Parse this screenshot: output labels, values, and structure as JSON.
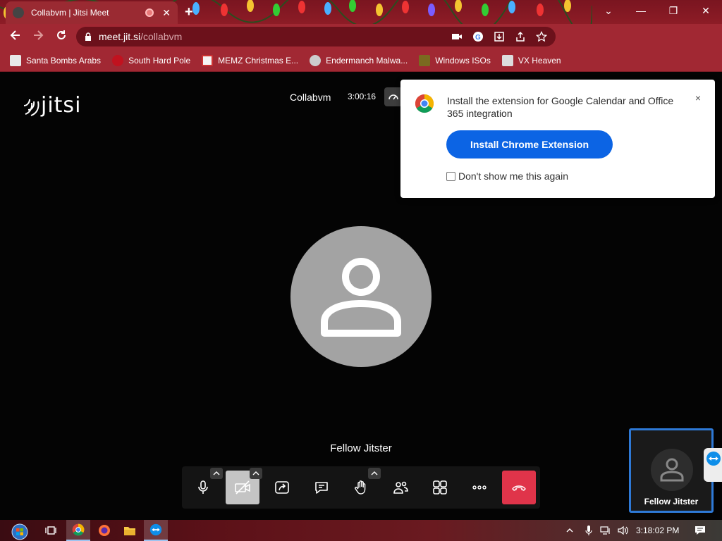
{
  "browser": {
    "tab_title": "Collabvm | Jitsi Meet",
    "new_tab_symbol": "+",
    "url_host": "meet.jit.si",
    "url_path": "/collabvm",
    "window_controls": [
      "chevron-down",
      "minimize",
      "restore",
      "close"
    ],
    "bookmarks": [
      {
        "label": "Santa Bombs Arabs",
        "icon": "santa-icon"
      },
      {
        "label": "South Hard Pole",
        "icon": "snowflake-icon"
      },
      {
        "label": "MEMZ Christmas E...",
        "icon": "memz-icon"
      },
      {
        "label": "Endermanch Malwa...",
        "icon": "endermanch-icon"
      },
      {
        "label": "Windows ISOs",
        "icon": "tree-icon"
      },
      {
        "label": "VX Heaven",
        "icon": "vx-heaven-icon"
      }
    ],
    "theme_color": "#a12833"
  },
  "meeting": {
    "logo_text": "jitsi",
    "conference_name": "Collabvm",
    "duration": "3:00:16",
    "participant_name": "Fellow Jitster",
    "thumbnail_name": "Fellow Jitster",
    "toolbar_buttons": [
      "microphone",
      "camera-off",
      "share-screen",
      "chat",
      "raise-hand",
      "participants",
      "tile-view",
      "more",
      "hang-up"
    ]
  },
  "popup": {
    "message": "Install the extension for Google Calendar and Office 365 integration",
    "close_symbol": "×",
    "button_label": "Install Chrome Extension",
    "checkbox_label": "Don't show me this again",
    "checkbox_checked": false,
    "button_color": "#0c64e4"
  },
  "taskbar": {
    "clock": "3:18:02 PM",
    "pinned": [
      "start",
      "task-view",
      "chrome",
      "firefox",
      "file-explorer",
      "teamviewer"
    ]
  }
}
